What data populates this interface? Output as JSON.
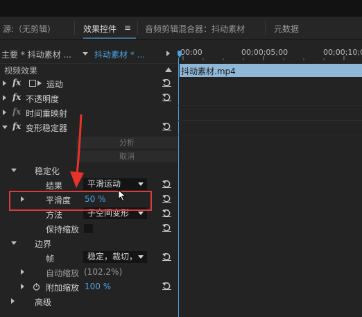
{
  "tabs": {
    "source": "源:（无剪辑）",
    "effect_controls": "效果控件",
    "menu_glyph": "≡",
    "audio_mixer": "音频剪辑混合器：抖动素材",
    "metadata": "元数据"
  },
  "header": {
    "master_label": "主要 * 抖动素材 ...",
    "clip_label": "抖动素材 * ...",
    "time_0": "00:00",
    "time_5": "00;00;05;00",
    "time_10": "00;00;10;0"
  },
  "timeline": {
    "clip_name": "抖动素材.mp4"
  },
  "effects": {
    "section_title": "视频效果",
    "motion": "运动",
    "opacity": "不透明度",
    "time_remap": "时间重映射",
    "warp_stabilizer": "变形稳定器",
    "analyze_btn": "分析",
    "cancel_btn": "取消",
    "stabilization": "稳定化",
    "result_label": "结果",
    "result_value": "平滑运动",
    "smoothness_label": "平滑度",
    "smoothness_value": "50 %",
    "method_label": "方法",
    "method_value": "子空间变形",
    "preserve_scale": "保持缩放",
    "borders": "边界",
    "framing_label": "帧",
    "framing_value": "稳定，裁切，",
    "auto_scale": "自动缩放",
    "auto_scale_value": "(102.2%)",
    "additional_scale": "附加缩放",
    "additional_scale_value": "100 %",
    "advanced": "高级"
  },
  "colors": {
    "accent": "#4aa3df",
    "highlight_box": "#d93c3c",
    "arrow": "#e8322a"
  }
}
